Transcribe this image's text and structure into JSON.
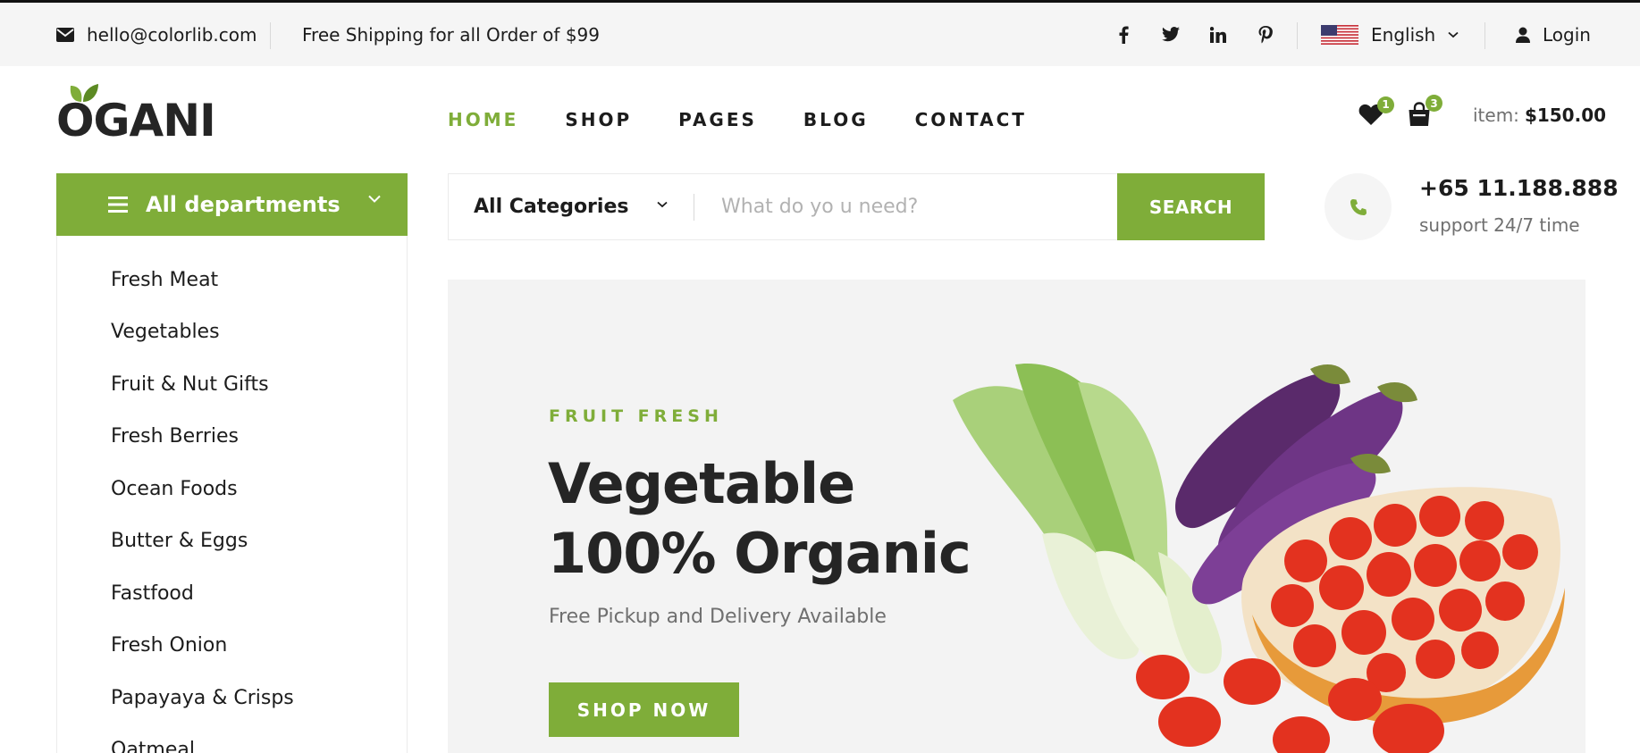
{
  "topbar": {
    "email": "hello@colorlib.com",
    "shipping": "Free Shipping for all Order of $99",
    "social": [
      "facebook-icon",
      "twitter-icon",
      "linkedin-icon",
      "pinterest-icon"
    ],
    "language": "English",
    "login": "Login"
  },
  "header": {
    "logo": "OGANI",
    "nav": [
      "HOME",
      "SHOP",
      "PAGES",
      "BLOG",
      "CONTACT"
    ],
    "active_nav": "HOME",
    "wishlist_count": "1",
    "cart_count": "3",
    "cart_label": "item:",
    "cart_total": "$150.00"
  },
  "departments": {
    "title": "All departments",
    "items": [
      "Fresh Meat",
      "Vegetables",
      "Fruit & Nut Gifts",
      "Fresh Berries",
      "Ocean Foods",
      "Butter & Eggs",
      "Fastfood",
      "Fresh Onion",
      "Papayaya & Crisps",
      "Oatmeal"
    ]
  },
  "search": {
    "category": "All Categories",
    "placeholder": "What do yo u need?",
    "button": "SEARCH"
  },
  "support": {
    "phone": "+65 11.188.888",
    "text": "support 24/7 time"
  },
  "hero": {
    "kicker": "FRUIT FRESH",
    "title_line1": "Vegetable",
    "title_line2": "100% Organic",
    "subtitle": "Free Pickup and Delivery Available",
    "button": "SHOP NOW"
  },
  "colors": {
    "accent": "#7fad39",
    "dark": "#1c1c1c",
    "muted": "#6f6f6f",
    "light_bg": "#f5f5f5"
  }
}
